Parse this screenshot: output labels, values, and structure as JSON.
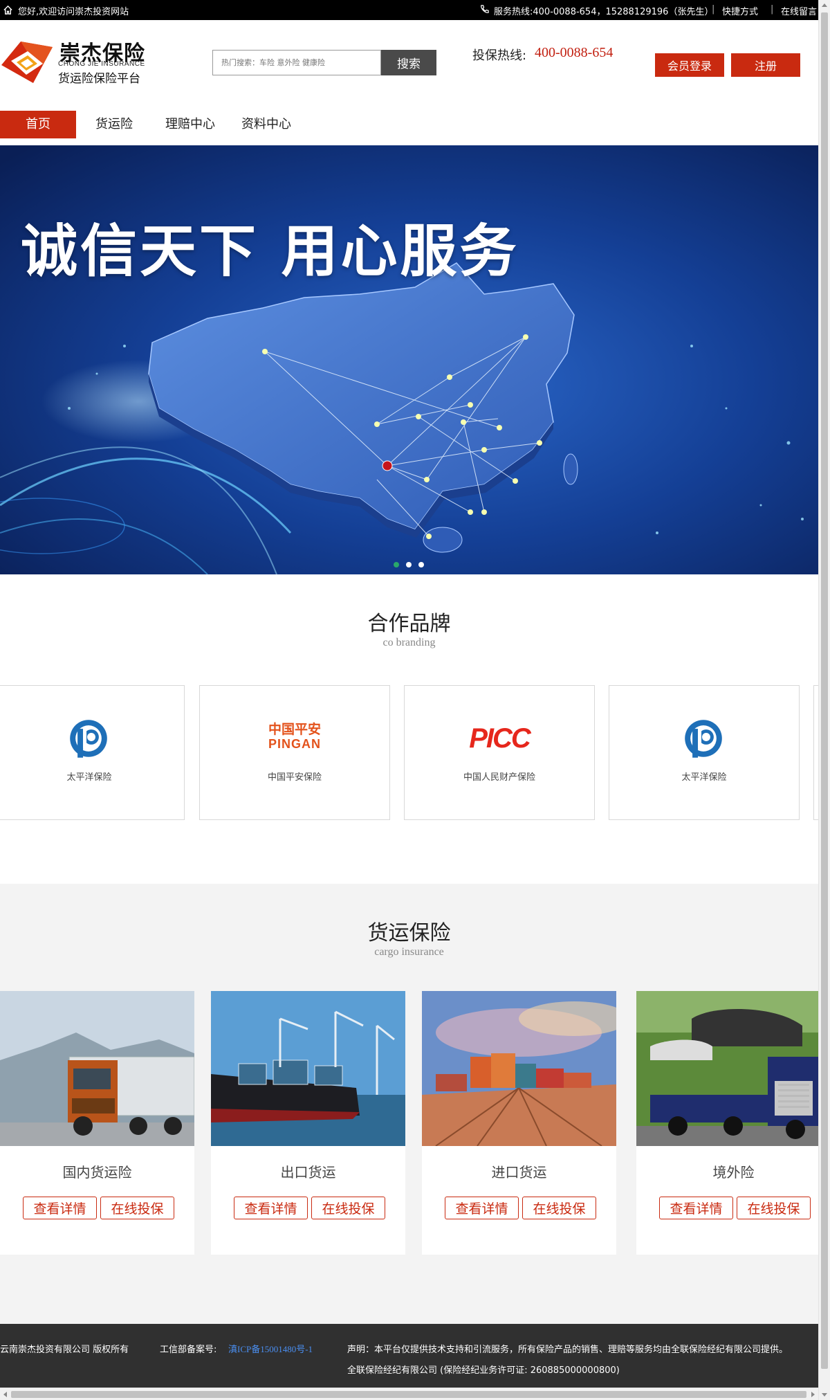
{
  "topbar": {
    "welcome": "您好,欢迎访问崇杰投资网站",
    "hotline": "服务热线:400-0088-654，15288129196（张先生）",
    "quick_links": "快捷方式",
    "message": "在线留言"
  },
  "header": {
    "logo_title": "崇杰保险",
    "logo_en": "CHONG JIE INSURANCE",
    "logo_sub": "货运险保险平台",
    "search_placeholder": "热门搜索：车险 意外险 健康险",
    "search_button": "搜索",
    "hotline_label": "投保热线:",
    "hotline_number": "400-0088-654",
    "login_button": "会员登录",
    "register_button": "注册"
  },
  "nav": {
    "items": [
      {
        "label": "首页"
      },
      {
        "label": "货运险"
      },
      {
        "label": "理赔中心"
      },
      {
        "label": "资料中心"
      }
    ]
  },
  "banner": {
    "title": "诚信天下 用心服务",
    "active_slide": 1,
    "slide_count": 3
  },
  "brands": {
    "title": "合作品牌",
    "subtitle": "co branding",
    "items": [
      {
        "name": "太平洋保险",
        "logo": "cpic-logo"
      },
      {
        "name": "中国平安保险",
        "logo_text_cn": "中国平安",
        "logo_text_en": "PINGAN"
      },
      {
        "name": "中国人民财产保险",
        "logo_text": "PICC"
      },
      {
        "name": "太平洋保险",
        "logo": "cpic-logo"
      }
    ]
  },
  "cargo": {
    "title": "货运保险",
    "subtitle": "cargo insurance",
    "detail_label": "查看详情",
    "apply_label": "在线投保",
    "items": [
      {
        "title": "国内货运险"
      },
      {
        "title": "出口货运"
      },
      {
        "title": "进口货运"
      },
      {
        "title": "境外险"
      }
    ]
  },
  "footer": {
    "copyright": "云南崇杰投资有限公司  版权所有",
    "icp_label": "工信部备案号:",
    "icp": "滇ICP备15001480号-1",
    "notice": "声明：本平台仅提供技术支持和引流服务，所有保险产品的销售、理赔等服务均由全联保险经纪有限公司提供。",
    "license": "全联保险经纪有限公司 (保险经纪业务许可证: 260885000000800)"
  },
  "colors": {
    "brand_red": "#c92a10",
    "topbar_bg": "#000000",
    "footer_bg": "#303030",
    "link_blue": "#4a8ef0"
  }
}
